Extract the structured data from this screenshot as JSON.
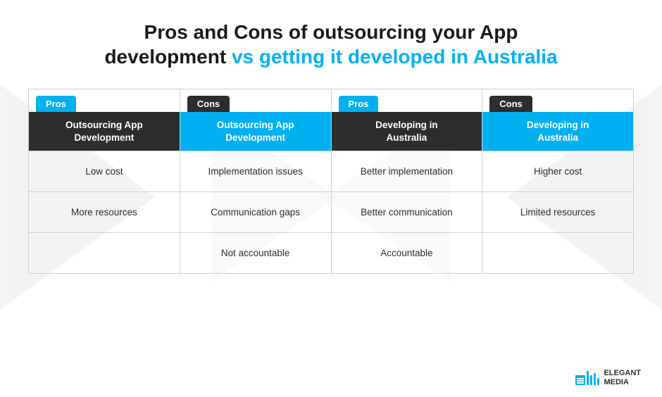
{
  "title": {
    "main": "Pros and Cons of outsourcing your App",
    "second_line_plain": "development ",
    "second_line_highlight": "vs getting it developed in Australia"
  },
  "badges": {
    "pros": "Pros",
    "cons": "Cons"
  },
  "columns": [
    {
      "id": "outsourcing-pros",
      "badge_type": "blue",
      "badge_label": "Pros",
      "header_type": "dark",
      "header": "Outsourcing App\nDevelopment",
      "cells": [
        "Low cost",
        "More resources",
        ""
      ]
    },
    {
      "id": "outsourcing-cons",
      "badge_type": "dark",
      "badge_label": "Cons",
      "header_type": "blue",
      "header": "Outsourcing App\nDevelopment",
      "cells": [
        "Implementation issues",
        "Communication gaps",
        "Not accountable"
      ]
    },
    {
      "id": "australia-pros",
      "badge_type": "blue",
      "badge_label": "Pros",
      "header_type": "dark",
      "header": "Developing in\nAustralia",
      "cells": [
        "Better implementation",
        "Better communication",
        "Accountable"
      ]
    },
    {
      "id": "australia-cons",
      "badge_type": "dark",
      "badge_label": "Cons",
      "header_type": "blue",
      "header": "Developing in\nAustralia",
      "cells": [
        "Higher cost",
        "Limited resources",
        ""
      ]
    }
  ],
  "logo": {
    "line1": "ELEGANT",
    "line2": "MEDIA"
  }
}
